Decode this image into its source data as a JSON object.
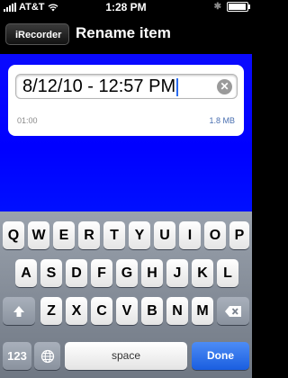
{
  "status_bar": {
    "carrier": "AT&T",
    "time": "1:28 PM"
  },
  "nav": {
    "back_label": "iRecorder",
    "title": "Rename item"
  },
  "item": {
    "name_value": "8/12/10 - 12:57 PM",
    "duration": "01:00",
    "size": "1.8 MB"
  },
  "keyboard": {
    "row1": [
      "Q",
      "W",
      "E",
      "R",
      "T",
      "Y",
      "U",
      "I",
      "O",
      "P"
    ],
    "row2": [
      "A",
      "S",
      "D",
      "F",
      "G",
      "H",
      "J",
      "K",
      "L"
    ],
    "row3": [
      "Z",
      "X",
      "C",
      "V",
      "B",
      "N",
      "M"
    ],
    "numbers_key": "123",
    "space_key": "space",
    "done_key": "Done"
  },
  "colors": {
    "content_background": "#0000ff",
    "done_key": "#1a5ee0",
    "size_text": "#4a6fb0"
  }
}
